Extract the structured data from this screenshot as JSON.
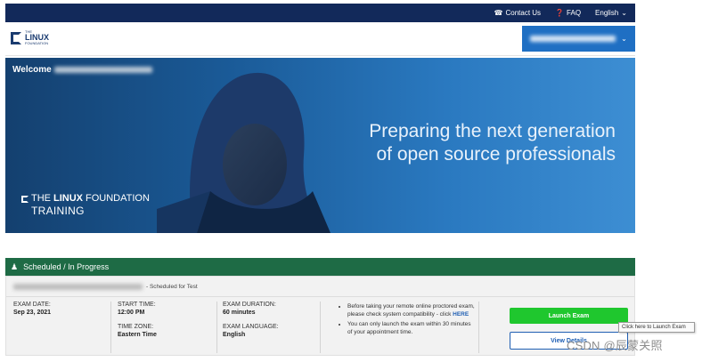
{
  "topbar": {
    "contact_label": "Contact Us",
    "faq_label": "FAQ",
    "language_label": "English",
    "bg_color": "#12295a"
  },
  "navbar": {
    "logo": {
      "line1": "THE",
      "line2": "LINUX",
      "line3": "FOUNDATION"
    },
    "user_button_color": "#1f6fc3"
  },
  "hero": {
    "welcome_label": "Welcome",
    "tagline_line1": "Preparing the next generation",
    "tagline_line2": "of open source professionals",
    "brand_the": "THE",
    "brand_linux": "LINUX",
    "brand_foundation": "FOUNDATION",
    "brand_training": "TRAINING"
  },
  "panel": {
    "title": "Scheduled / In Progress",
    "header_color": "#1e6b45",
    "status_suffix": "- Scheduled for Test",
    "exam_date_label": "EXAM DATE:",
    "exam_date_value": "Sep 23, 2021",
    "start_time_label": "START TIME:",
    "start_time_value": "12:00 PM",
    "time_zone_label": "TIME ZONE:",
    "time_zone_value": "Eastern Time",
    "duration_label": "EXAM DURATION:",
    "duration_value": "60 minutes",
    "language_label": "EXAM LANGUAGE:",
    "language_value": "English",
    "note1_text": "Before taking your remote online proctored exam, please check system compatibility - click",
    "note1_link": "HERE",
    "note2_text": "You can only launch the exam within 30 minutes of your appointment time.",
    "launch_label": "Launch Exam",
    "launch_color": "#1fc72e",
    "view_details_label": "View Details"
  },
  "tooltip": {
    "text": "Click here to Launch Exam"
  },
  "watermark": {
    "text": "CSDN @辰蒙关照"
  }
}
